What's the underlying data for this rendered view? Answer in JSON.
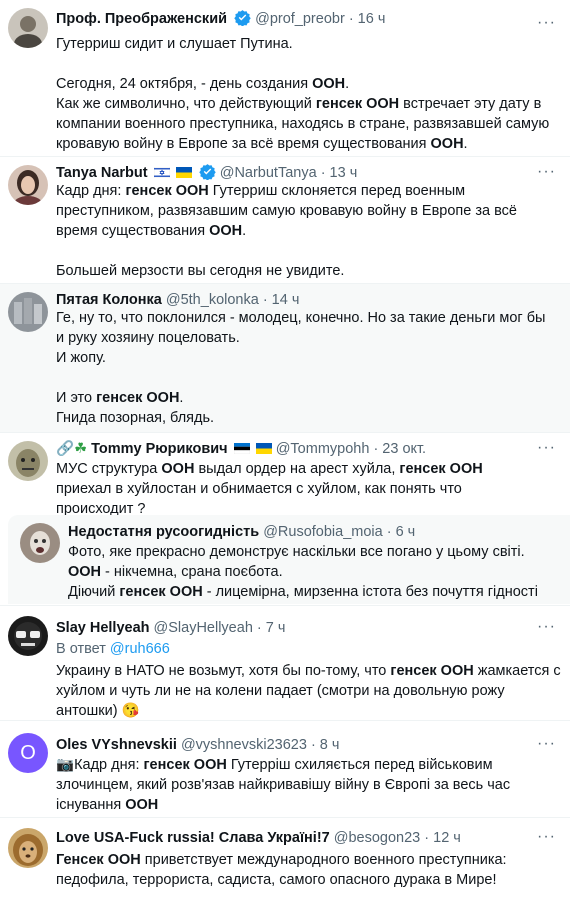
{
  "tweets": [
    {
      "name": "Проф. Преображенский",
      "handle": "@prof_preobr",
      "time": "· 16 ч",
      "p1": "Гутерриш сидит и слушает Путина.",
      "p2a": "Сегодня, 24 октября, - день создания ",
      "p2b": "ООН",
      "p2c": ".",
      "p3a": "Как же символично, что действующий ",
      "p3b": "генсек ООН",
      "p3c": " встречает эту дату в компании военного преступника, находясь в стране, развязавшей самую кровавую войну в Европе за всё время существования ",
      "p3d": "ООН",
      "p3e": "."
    },
    {
      "name": "Tanya Narbut",
      "handle": "@NarbutTanya",
      "time": "· 13 ч",
      "p1a": "Кадр дня: ",
      "p1b": "генсек ООН",
      "p1c": " Гутерриш склоняется перед военным преступником, развязавшим самую кровавую войну в Европе за всё время существования ",
      "p1d": "ООН",
      "p1e": ".",
      "p2": "Большей мерзости вы сегодня не увидите."
    },
    {
      "name": "Пятая Колонка",
      "handle": "@5th_kolonka",
      "time": "· 14 ч",
      "l1": "Ге, ну то, что поклонился - молодец, конечно. Но за такие деньги мог бы и руку хозяину поцеловать.",
      "l2": "И жопу.",
      "l3a": "И это ",
      "l3b": "генсек ООН",
      "l3c": ".",
      "l4": "Гнида позорная, блядь."
    },
    {
      "name": "Tommy Рюрикович",
      "handle": "@Tommypohh",
      "time": "· 23 окт.",
      "t1": "МУС структура ",
      "t2": "ООН",
      "t3": " выдал ордер на арест хуйла, ",
      "t4": "генсек ООН",
      "t5": " приехал в хуйлостан и обнимается с хуйлом, как понять что происходит ?"
    },
    {
      "name": "Недостатня русоогидність",
      "handle": "@Rusofobia_moia",
      "time": "· 6 ч",
      "l1": "Фото, яке прекрасно демонструє наскільки все погано у цьому світі.",
      "l2a": "ООН",
      "l2b": " - нікчемна, срана поєбота.",
      "l3a": "Діючий ",
      "l3b": "генсек ООН",
      "l3c": " - лицемірна, мирзенна істота без почуття гідності"
    },
    {
      "name": "Slay Hellyeah",
      "handle": "@SlayHellyeah",
      "time": "· 7 ч",
      "reply_prefix": "В ответ ",
      "reply_handle": "@ruh666",
      "t1": "Украину в НАТО не возьмут, хотя бы по-тому, что ",
      "t2": "генсек ООН",
      "t3": " жамкается с хуйлом и чуть ли не на колени падает (смотри на довольную рожу антошки) ",
      "emoji": "😘"
    },
    {
      "name": "Oles VYshnevskii",
      "handle": "@vyshnevski23623",
      "time": "· 8 ч",
      "avatar_letter": "O",
      "t0": "📷",
      "t1": "Кадр дня: ",
      "t2": "генсек ООН",
      "t3": " Гутерріш схиляється перед військовим злочинцем, який розв'язав найкривавішу війну в Європі за весь час існування ",
      "t4": "ООН"
    },
    {
      "name": "Love USA-Fuck russia! Слава Україні!7",
      "handle": "@besogon23",
      "time": "· 12 ч",
      "t1": "Генсек ООН",
      "t2": " приветствует международного военного преступника: педофила, террориста, садиста, самого опасного дурака в Мире!"
    }
  ],
  "more_icon": "···",
  "accent": "#1d9bf0"
}
